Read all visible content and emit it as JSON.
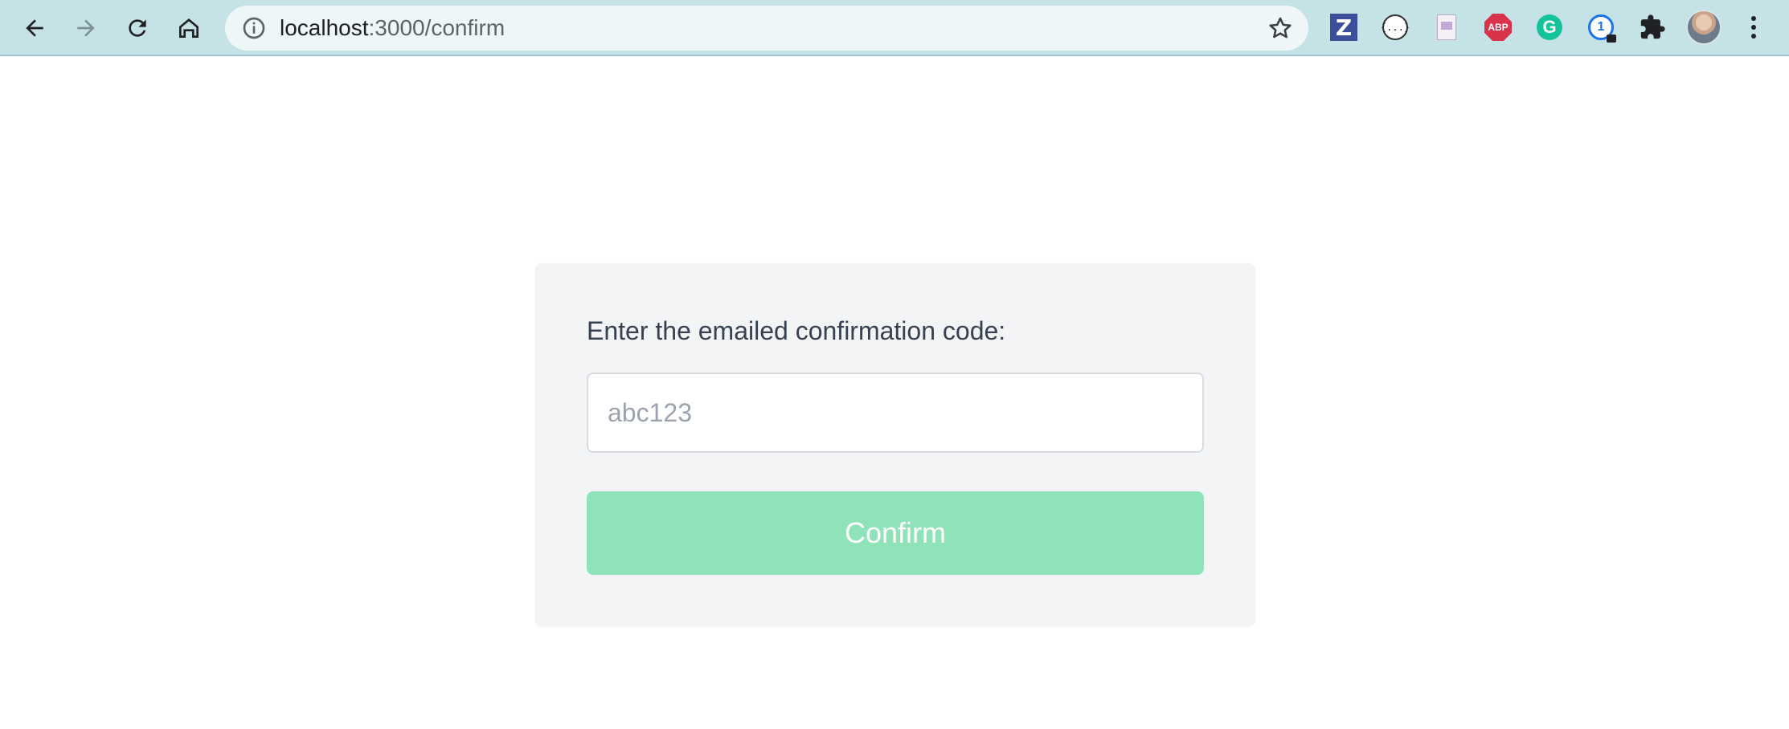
{
  "browser": {
    "url_host": "localhost",
    "url_path": ":3000/confirm",
    "icons": {
      "back": "arrow-left-icon",
      "forward": "arrow-right-icon",
      "reload": "reload-icon",
      "home": "home-icon",
      "info": "info-icon",
      "bookmark": "star-icon",
      "menu": "kebab-menu-icon"
    },
    "extensions": {
      "zotero": "Z",
      "json_viewer": "{...}",
      "adblock": "ABP",
      "grammarly": "G",
      "onepassword": "1"
    }
  },
  "confirm_form": {
    "label": "Enter the emailed confirmation code:",
    "input_value": "",
    "input_placeholder": "abc123",
    "button_label": "Confirm"
  },
  "colors": {
    "toolbar_bg": "#c5e2e6",
    "card_bg": "#f3f4f6",
    "button_bg": "#8ee4b8",
    "label_text": "#374151",
    "placeholder_text": "#9ca3af"
  }
}
